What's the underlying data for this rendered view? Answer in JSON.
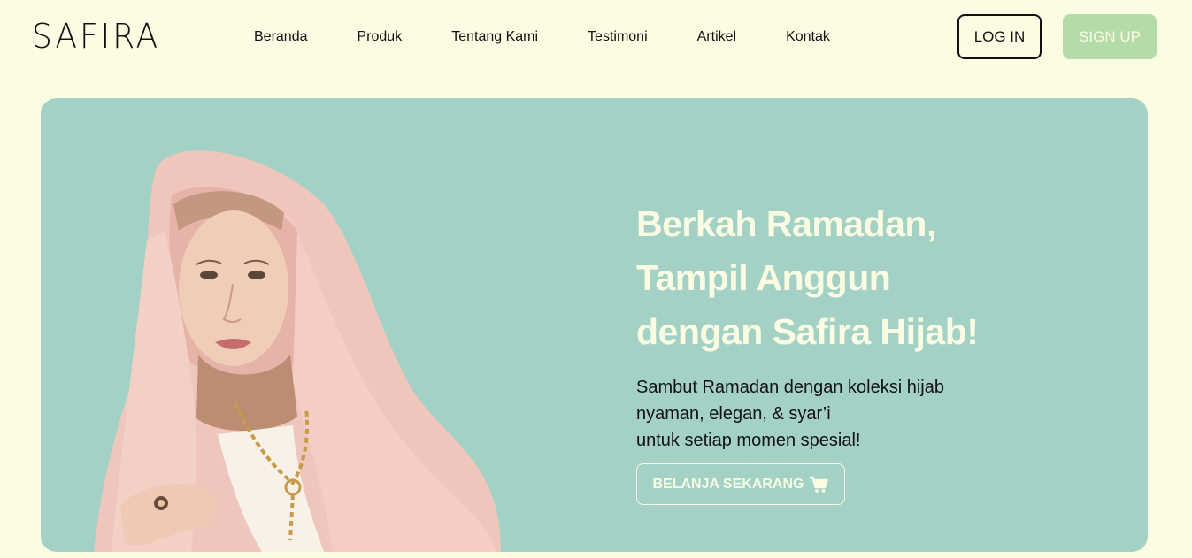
{
  "brand": {
    "logo_text": "SAFIRA"
  },
  "nav": {
    "items": [
      {
        "label": "Beranda"
      },
      {
        "label": "Produk"
      },
      {
        "label": "Tentang Kami"
      },
      {
        "label": "Testimoni"
      },
      {
        "label": "Artikel"
      },
      {
        "label": "Kontak"
      }
    ]
  },
  "auth": {
    "login_label": "LOG IN",
    "signup_label": "SIGN UP"
  },
  "hero": {
    "title_lines": [
      "Berkah Ramadan,",
      "Tampil Anggun",
      "dengan Safira Hijab!"
    ],
    "subtitle_lines": [
      "Sambut Ramadan dengan koleksi hijab",
      "nyaman, elegan, & syar’i",
      "untuk setiap momen spesial!"
    ],
    "cta_label": "BELANJA SEKARANG",
    "cta_icon": "cart-icon",
    "image_icon": "hijab-model-photo"
  },
  "colors": {
    "page_background": "#fbfde3",
    "hero_background": "#a3d1c5",
    "signup_button": "#b5dbab",
    "hero_text": "#fbfde3"
  }
}
